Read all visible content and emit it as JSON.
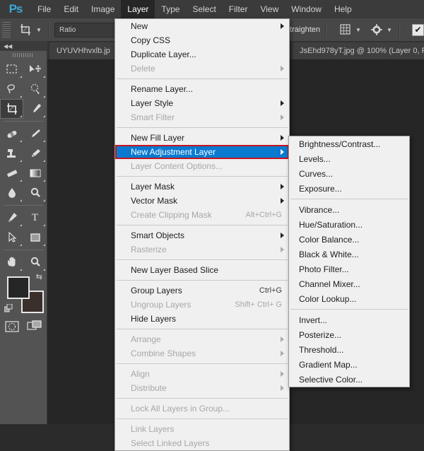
{
  "app": {
    "logo": "Ps",
    "accent_blue": "#3ea6d8",
    "highlight_blue": "#0a7ad1",
    "highlight_border_red": "#c41420"
  },
  "menubar": {
    "items": [
      {
        "label": "File",
        "active": false
      },
      {
        "label": "Edit",
        "active": false
      },
      {
        "label": "Image",
        "active": false
      },
      {
        "label": "Layer",
        "active": true
      },
      {
        "label": "Type",
        "active": false
      },
      {
        "label": "Select",
        "active": false
      },
      {
        "label": "Filter",
        "active": false
      },
      {
        "label": "View",
        "active": false
      },
      {
        "label": "Window",
        "active": false
      },
      {
        "label": "Help",
        "active": false
      }
    ]
  },
  "optionsbar": {
    "tool_icon": "crop-tool-icon",
    "preset_value": "Ratio",
    "straighten_label": "Straighten",
    "overlay_icon": "grid-overlay-icon",
    "settings_icon": "gear-icon",
    "delete_cropped_checked": true
  },
  "tabs": [
    {
      "label": "UYUVHhvxlb.jp",
      "active": false
    },
    {
      "label": "JsEhd978yT.jpg @ 100% (Layer 0, F",
      "active": true
    }
  ],
  "toolpanel": {
    "collapse_icon": "double-chevron-left-icon",
    "tools": [
      {
        "name": "rectangular-marquee-tool",
        "icon": "marquee-icon",
        "selected": false
      },
      {
        "name": "move-tool",
        "icon": "move-icon",
        "selected": false
      },
      {
        "name": "lasso-tool",
        "icon": "lasso-icon",
        "selected": false
      },
      {
        "name": "quick-selection-tool",
        "icon": "quick-select-icon",
        "selected": false
      },
      {
        "name": "crop-tool",
        "icon": "crop-icon",
        "selected": true
      },
      {
        "name": "eyedropper-tool",
        "icon": "eyedropper-icon",
        "selected": false
      },
      {
        "name": "spot-healing-brush-tool",
        "icon": "bandage-icon",
        "selected": false
      },
      {
        "name": "brush-tool",
        "icon": "brush-icon",
        "selected": false
      },
      {
        "name": "clone-stamp-tool",
        "icon": "stamp-icon",
        "selected": false
      },
      {
        "name": "history-brush-tool",
        "icon": "history-brush-icon",
        "selected": false
      },
      {
        "name": "eraser-tool",
        "icon": "eraser-icon",
        "selected": false
      },
      {
        "name": "gradient-tool",
        "icon": "gradient-icon",
        "selected": false
      },
      {
        "name": "blur-tool",
        "icon": "droplet-icon",
        "selected": false
      },
      {
        "name": "dodge-tool",
        "icon": "dodge-icon",
        "selected": false
      },
      {
        "name": "pen-tool",
        "icon": "pen-icon",
        "selected": false
      },
      {
        "name": "type-tool",
        "icon": "text-T-icon",
        "selected": false
      },
      {
        "name": "path-selection-tool",
        "icon": "arrow-cursor-icon",
        "selected": false
      },
      {
        "name": "rectangle-tool",
        "icon": "rectangle-shape-icon",
        "selected": false
      },
      {
        "name": "hand-tool",
        "icon": "hand-icon",
        "selected": false
      },
      {
        "name": "zoom-tool",
        "icon": "magnifier-icon",
        "selected": false
      }
    ],
    "swatches": {
      "foreground": "#262626",
      "background": "#3a2f2a",
      "swap_icon": "swap-colors-icon",
      "reset_icon": "reset-colors-icon"
    },
    "quickmask_icon": "quick-mask-icon",
    "screenmode_icon": "screen-mode-icon"
  },
  "layer_menu": {
    "items": [
      {
        "label": "New",
        "accel": "",
        "submenu": true,
        "disabled": false,
        "highlight": false
      },
      {
        "label": "Copy CSS",
        "accel": "",
        "submenu": false,
        "disabled": false,
        "highlight": false
      },
      {
        "label": "Duplicate Layer...",
        "accel": "",
        "submenu": false,
        "disabled": false,
        "highlight": false
      },
      {
        "label": "Delete",
        "accel": "",
        "submenu": true,
        "disabled": true,
        "highlight": false
      },
      {
        "separator": true
      },
      {
        "label": "Rename Layer...",
        "accel": "",
        "submenu": false,
        "disabled": false,
        "highlight": false
      },
      {
        "label": "Layer Style",
        "accel": "",
        "submenu": true,
        "disabled": false,
        "highlight": false
      },
      {
        "label": "Smart Filter",
        "accel": "",
        "submenu": true,
        "disabled": true,
        "highlight": false
      },
      {
        "separator": true
      },
      {
        "label": "New Fill Layer",
        "accel": "",
        "submenu": true,
        "disabled": false,
        "highlight": false
      },
      {
        "label": "New Adjustment Layer",
        "accel": "",
        "submenu": true,
        "disabled": false,
        "highlight": true
      },
      {
        "label": "Layer Content Options...",
        "accel": "",
        "submenu": false,
        "disabled": true,
        "highlight": false
      },
      {
        "separator": true
      },
      {
        "label": "Layer Mask",
        "accel": "",
        "submenu": true,
        "disabled": false,
        "highlight": false
      },
      {
        "label": "Vector Mask",
        "accel": "",
        "submenu": true,
        "disabled": false,
        "highlight": false
      },
      {
        "label": "Create Clipping Mask",
        "accel": "Alt+Ctrl+G",
        "submenu": false,
        "disabled": true,
        "highlight": false
      },
      {
        "separator": true
      },
      {
        "label": "Smart Objects",
        "accel": "",
        "submenu": true,
        "disabled": false,
        "highlight": false
      },
      {
        "label": "Rasterize",
        "accel": "",
        "submenu": true,
        "disabled": true,
        "highlight": false
      },
      {
        "separator": true
      },
      {
        "label": "New Layer Based Slice",
        "accel": "",
        "submenu": false,
        "disabled": false,
        "highlight": false
      },
      {
        "separator": true
      },
      {
        "label": "Group Layers",
        "accel": "Ctrl+G",
        "submenu": false,
        "disabled": false,
        "highlight": false
      },
      {
        "label": "Ungroup Layers",
        "accel": "Shift+ Ctrl+ G",
        "submenu": false,
        "disabled": true,
        "highlight": false
      },
      {
        "label": "Hide Layers",
        "accel": "",
        "submenu": false,
        "disabled": false,
        "highlight": false
      },
      {
        "separator": true
      },
      {
        "label": "Arrange",
        "accel": "",
        "submenu": true,
        "disabled": true,
        "highlight": false
      },
      {
        "label": "Combine Shapes",
        "accel": "",
        "submenu": true,
        "disabled": true,
        "highlight": false
      },
      {
        "separator": true
      },
      {
        "label": "Align",
        "accel": "",
        "submenu": true,
        "disabled": true,
        "highlight": false
      },
      {
        "label": "Distribute",
        "accel": "",
        "submenu": true,
        "disabled": true,
        "highlight": false
      },
      {
        "separator": true
      },
      {
        "label": "Lock All Layers in Group...",
        "accel": "",
        "submenu": false,
        "disabled": true,
        "highlight": false
      },
      {
        "separator": true
      },
      {
        "label": "Link Layers",
        "accel": "",
        "submenu": false,
        "disabled": true,
        "highlight": false
      },
      {
        "label": "Select Linked Layers",
        "accel": "",
        "submenu": false,
        "disabled": true,
        "highlight": false
      }
    ]
  },
  "adjustment_submenu": {
    "items": [
      {
        "label": "Brightness/Contrast...",
        "disabled": false
      },
      {
        "label": "Levels...",
        "disabled": false
      },
      {
        "label": "Curves...",
        "disabled": false
      },
      {
        "label": "Exposure...",
        "disabled": false
      },
      {
        "separator": true
      },
      {
        "label": "Vibrance...",
        "disabled": false
      },
      {
        "label": "Hue/Saturation...",
        "disabled": false
      },
      {
        "label": "Color Balance...",
        "disabled": false
      },
      {
        "label": "Black & White...",
        "disabled": false
      },
      {
        "label": "Photo Filter...",
        "disabled": false
      },
      {
        "label": "Channel Mixer...",
        "disabled": false
      },
      {
        "label": "Color Lookup...",
        "disabled": false
      },
      {
        "separator": true
      },
      {
        "label": "Invert...",
        "disabled": false
      },
      {
        "label": "Posterize...",
        "disabled": false
      },
      {
        "label": "Threshold...",
        "disabled": false
      },
      {
        "label": "Gradient Map...",
        "disabled": false
      },
      {
        "label": "Selective Color...",
        "disabled": false
      }
    ]
  }
}
